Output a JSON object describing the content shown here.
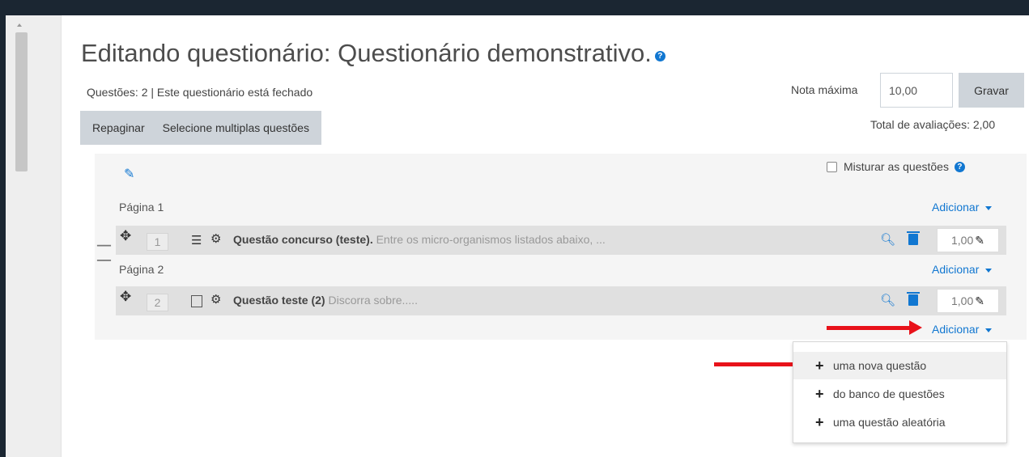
{
  "title": "Editando questionário: Questionário demonstrativo.",
  "status": "Questões: 2 | Este questionário está fechado",
  "toolbar": {
    "repaginate": "Repaginar",
    "select_multiple": "Selecione multiplas questões"
  },
  "grade": {
    "label": "Nota máxima",
    "value": "10,00",
    "save": "Gravar",
    "total": "Total de avaliações: 2,00"
  },
  "shuffle_label": "Misturar as questões",
  "pages": [
    {
      "label": "Página 1",
      "add": "Adicionar"
    },
    {
      "label": "Página 2",
      "add": "Adicionar"
    }
  ],
  "final_add": "Adicionar",
  "questions": [
    {
      "number": "1",
      "name": "Questão concurso (teste).",
      "text": "Entre os micro-organismos listados abaixo, ...",
      "mark": "1,00",
      "type_icon": "multichoice-icon"
    },
    {
      "number": "2",
      "name": "Questão teste (2)",
      "text": "Discorra sobre.....",
      "mark": "1,00",
      "type_icon": "essay-icon"
    }
  ],
  "add_menu": [
    "uma nova questão",
    "do banco de questões",
    "uma questão aleatória"
  ],
  "colors": {
    "accent": "#1177d1",
    "arrow": "#e8121a"
  }
}
